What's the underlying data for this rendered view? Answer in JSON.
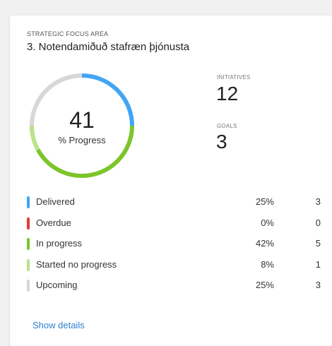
{
  "card": {
    "eyebrow": "STRATEGIC FOCUS AREA",
    "title": "3. Notendamiðuð stafræn þjónusta"
  },
  "progress": {
    "value": "41",
    "label": "% Progress",
    "ring": [
      {
        "status": "delivered",
        "fraction": 0.25,
        "color": "#42a5f5"
      },
      {
        "status": "overdue",
        "fraction": 0.0,
        "color": "#e53935"
      },
      {
        "status": "in_progress",
        "fraction": 0.42,
        "color": "#7cc52a"
      },
      {
        "status": "started_no_progress",
        "fraction": 0.08,
        "color": "#b8e38a"
      },
      {
        "status": "upcoming",
        "fraction": 0.25,
        "color": "#d7d7d7"
      }
    ]
  },
  "stats": {
    "initiatives_label": "INITIATIVES",
    "initiatives_value": "12",
    "goals_label": "GOALS",
    "goals_value": "3"
  },
  "legend": [
    {
      "label": "Delivered",
      "pct": "25%",
      "count": "3",
      "color": "#42a5f5"
    },
    {
      "label": "Overdue",
      "pct": "0%",
      "count": "0",
      "color": "#e53935"
    },
    {
      "label": "In progress",
      "pct": "42%",
      "count": "5",
      "color": "#7cc52a"
    },
    {
      "label": "Started no progress",
      "pct": "8%",
      "count": "1",
      "color": "#b8e38a"
    },
    {
      "label": "Upcoming",
      "pct": "25%",
      "count": "3",
      "color": "#d7d7d7"
    }
  ],
  "footer": {
    "show_details": "Show details"
  }
}
